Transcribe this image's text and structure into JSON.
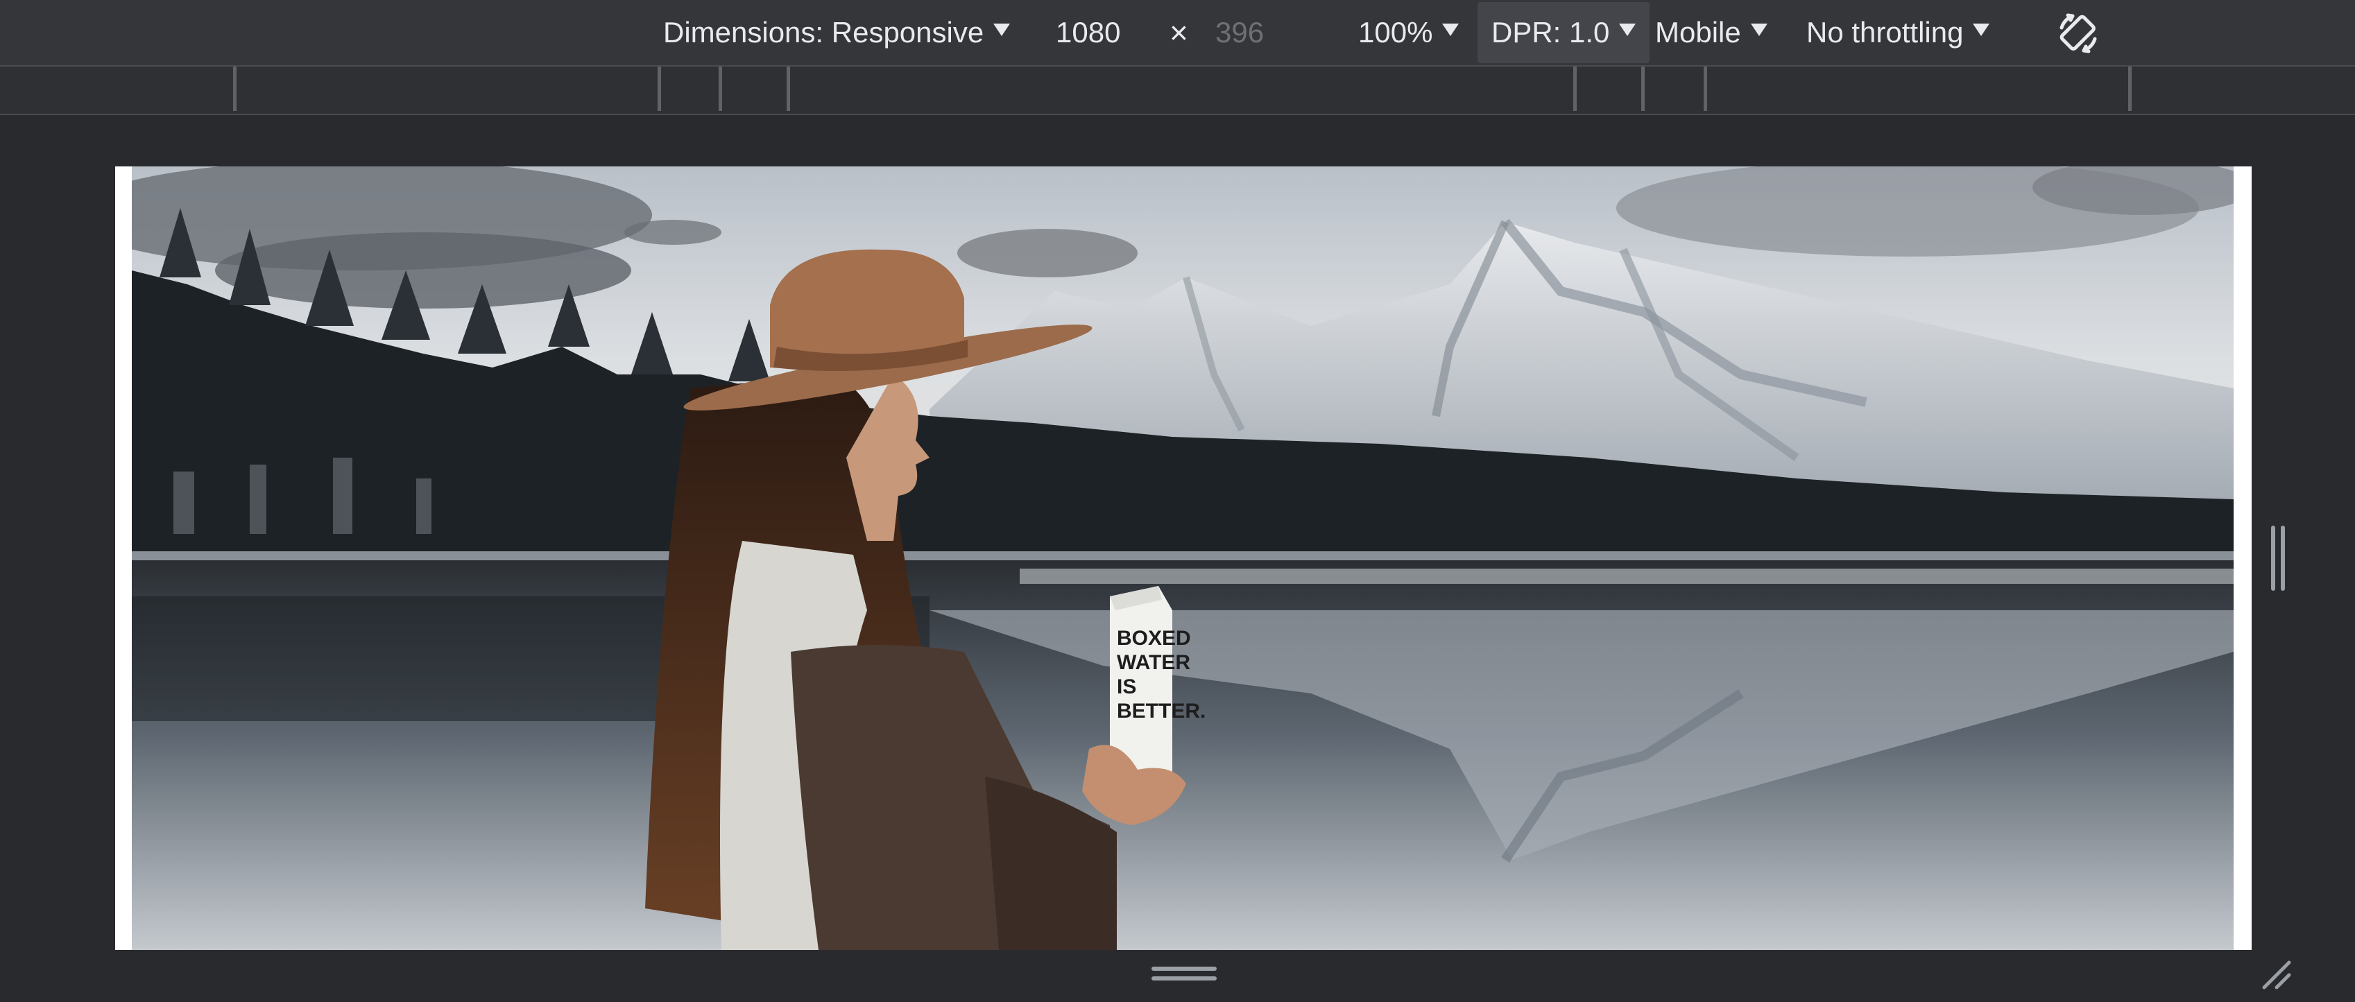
{
  "toolbar": {
    "dimensions_label": "Dimensions: Responsive",
    "width_value": "1080",
    "times_glyph": "×",
    "height_placeholder": "396",
    "zoom_label": "100%",
    "dpr_label": "DPR: 1.0",
    "device_type_label": "Mobile",
    "throttling_label": "No throttling",
    "rotate_icon": "rotate-icon"
  },
  "viewport": {
    "image_description_text": "BOXED WATER IS BETTER.",
    "carton_lines": [
      "BOXED",
      "WATER",
      "IS",
      "BETTER."
    ]
  },
  "colors": {
    "toolbar_bg": "#35363a",
    "page_bg": "#292a2d",
    "text": "#e8eaed",
    "muted": "#6f7074",
    "handle": "#9aa0a6"
  }
}
